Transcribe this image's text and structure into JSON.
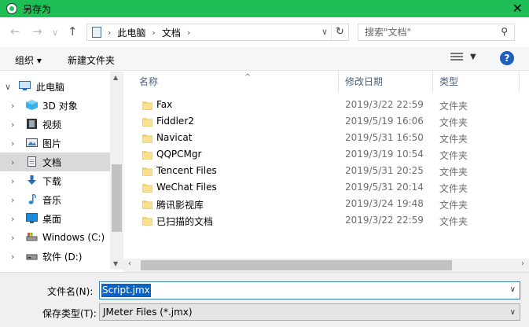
{
  "window": {
    "title": "另存为"
  },
  "nav": {
    "back": "←",
    "forward": "→",
    "recent": "∨",
    "up": "↑",
    "breadcrumb": [
      "此电脑",
      "文档"
    ],
    "refresh": "↻",
    "search_placeholder": "搜索\"文档\""
  },
  "toolbar": {
    "organize": "组织 ▾",
    "new_folder": "新建文件夹",
    "help": "?"
  },
  "sidebar": {
    "items": [
      {
        "label": "此电脑",
        "icon": "computer-icon"
      },
      {
        "label": "3D 对象",
        "icon": "cube-icon"
      },
      {
        "label": "视频",
        "icon": "film-icon"
      },
      {
        "label": "图片",
        "icon": "picture-icon"
      },
      {
        "label": "文档",
        "icon": "document-icon"
      },
      {
        "label": "下载",
        "icon": "download-icon"
      },
      {
        "label": "音乐",
        "icon": "music-icon"
      },
      {
        "label": "桌面",
        "icon": "desktop-icon"
      },
      {
        "label": "Windows (C:)",
        "icon": "drive-c-icon"
      },
      {
        "label": "软件 (D:)",
        "icon": "drive-d-icon"
      }
    ]
  },
  "columns": {
    "name": "名称",
    "date": "修改日期",
    "type": "类型"
  },
  "files": [
    {
      "name": "Fax",
      "date": "2019/3/22 22:59",
      "type": "文件夹"
    },
    {
      "name": "Fiddler2",
      "date": "2019/5/19 16:06",
      "type": "文件夹"
    },
    {
      "name": "Navicat",
      "date": "2019/5/31 16:50",
      "type": "文件夹"
    },
    {
      "name": "QQPCMgr",
      "date": "2019/3/19 10:54",
      "type": "文件夹"
    },
    {
      "name": "Tencent Files",
      "date": "2019/5/31 20:25",
      "type": "文件夹"
    },
    {
      "name": "WeChat Files",
      "date": "2019/5/31 20:14",
      "type": "文件夹"
    },
    {
      "name": "腾讯影视库",
      "date": "2019/3/24 19:48",
      "type": "文件夹"
    },
    {
      "name": "已扫描的文档",
      "date": "2019/3/22 22:59",
      "type": "文件夹"
    }
  ],
  "form": {
    "filename_label": "文件名(N):",
    "filename_value": "Script.jmx",
    "filetype_label": "保存类型(T):",
    "filetype_value": "JMeter Files (*.jmx)"
  },
  "colors": {
    "titlebar": "#1fbf58",
    "selection": "#0a64c8",
    "sidebar_selected": "#d9d9d9"
  }
}
